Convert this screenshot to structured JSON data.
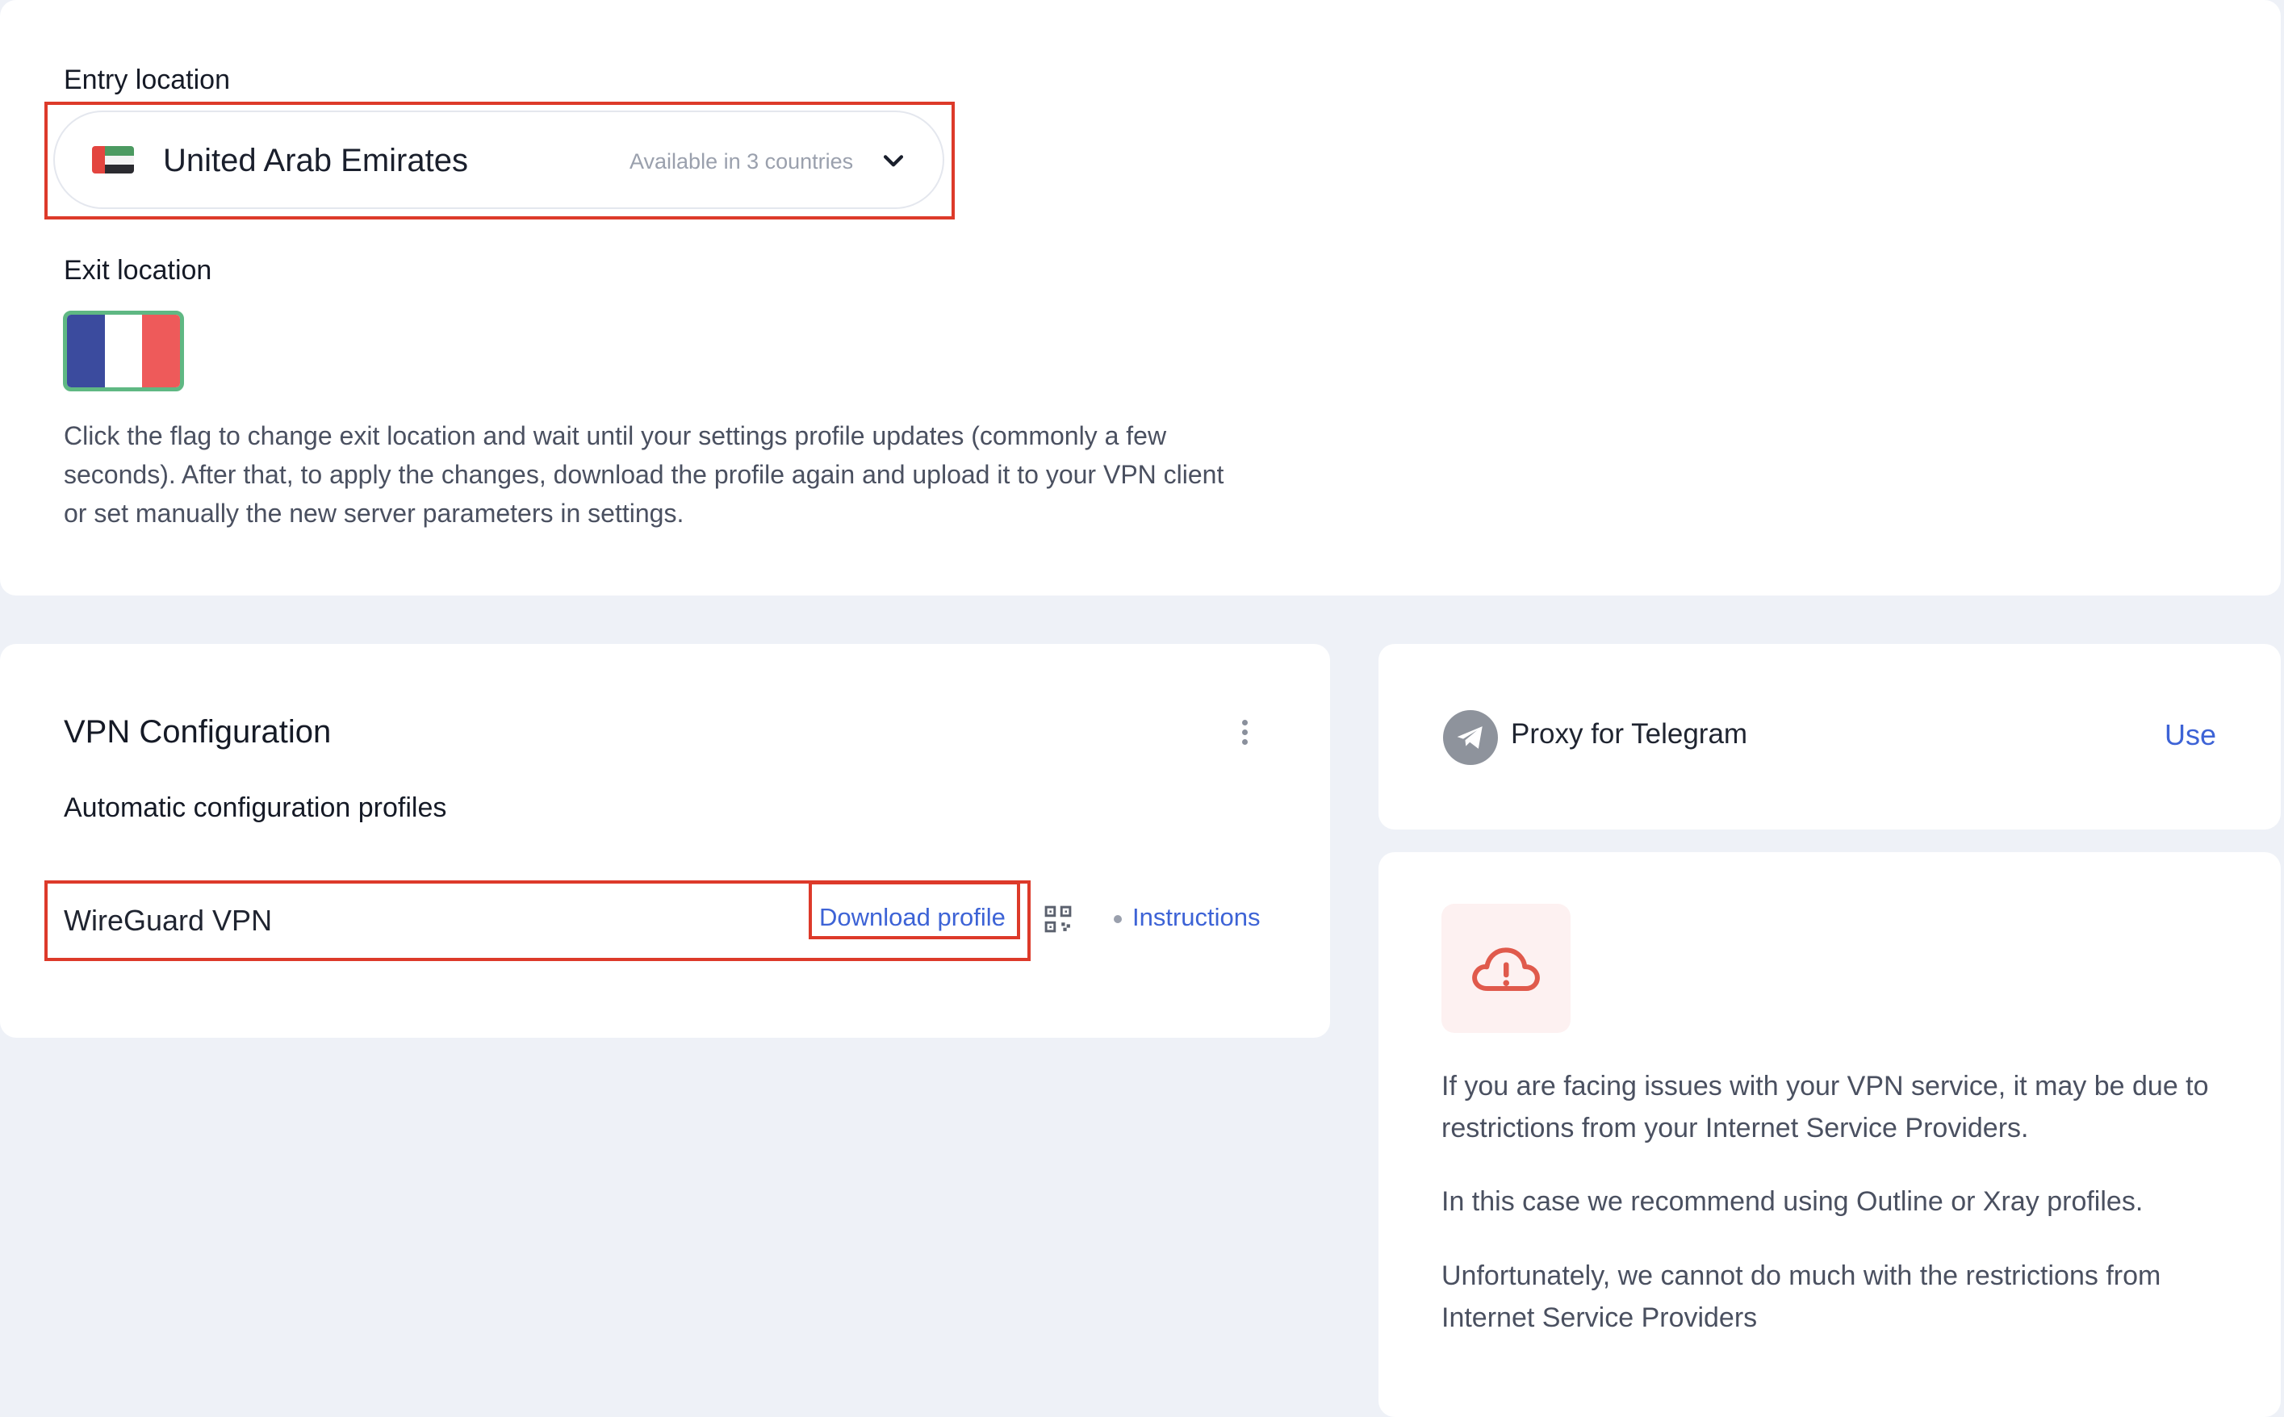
{
  "location": {
    "entry_label": "Entry location",
    "entry_value": "United Arab Emirates",
    "entry_hint": "Available in 3 countries",
    "exit_label": "Exit location",
    "exit_flag": "france-flag",
    "description": "Click the flag to change exit location and wait until your settings profile updates (commonly a few seconds). After that, to apply the changes, download the profile again and upload it to your VPN client or set manually the new server parameters in settings."
  },
  "vpn": {
    "title": "VPN Configuration",
    "subtitle": "Automatic configuration profiles",
    "profile_name": "WireGuard VPN",
    "download_label": "Download profile",
    "instructions_label": "Instructions"
  },
  "telegram": {
    "label": "Proxy for Telegram",
    "use_label": "Use"
  },
  "issues": {
    "p1": "If you are facing issues with your VPN service, it may be due to restrictions from your Internet Service Providers.",
    "p2": "In this case we recommend using Outline or Xray profiles.",
    "p3": "Unfortunately, we cannot do much with the restrictions from Internet Service Providers"
  },
  "colors": {
    "accent": "#3d63d6",
    "highlight": "#dd3a2a",
    "selected_flag_border": "#5fb883"
  }
}
